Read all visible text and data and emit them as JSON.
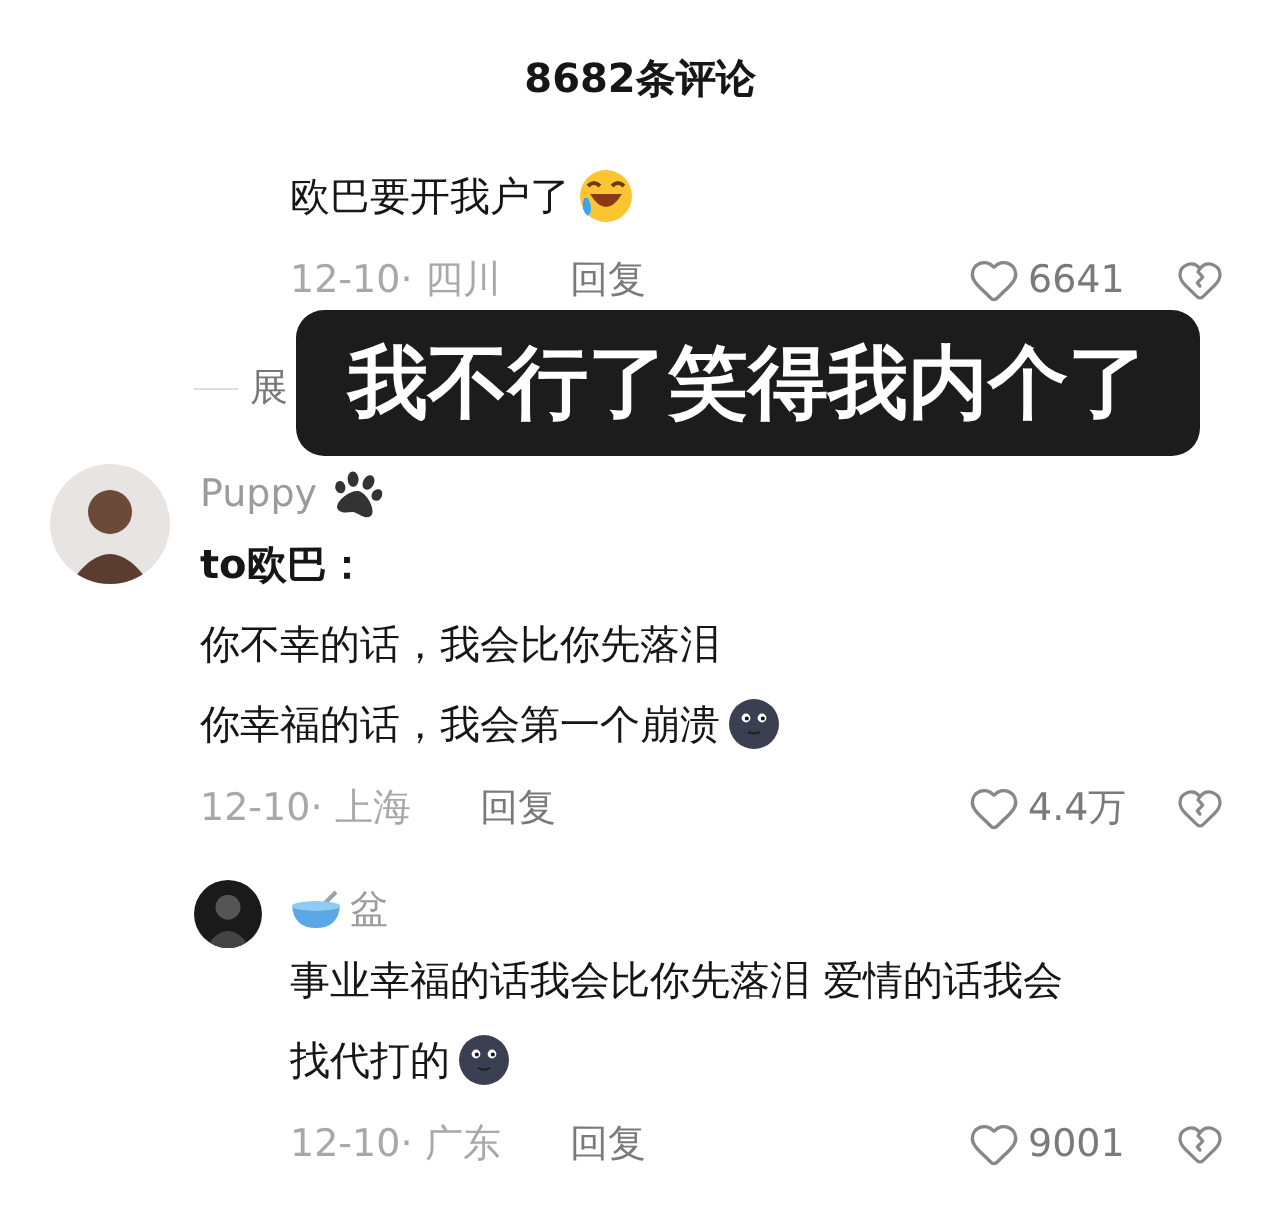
{
  "header": {
    "title": "8682条评论"
  },
  "comments": [
    {
      "indent": true,
      "lines": [
        "欧巴要开我户了"
      ],
      "emoji": {
        "kind": "laughing"
      },
      "meta": "12-10· 四川",
      "reply": "回复",
      "likes": "6641"
    },
    {
      "indent": false,
      "author": "Puppy",
      "badge": {
        "kind": "paw"
      },
      "lines": [
        "to欧巴：",
        "你不幸的话，我会比你先落泪",
        "你幸福的话，我会第一个崩溃"
      ],
      "emoji": {
        "kind": "moon"
      },
      "meta": "12-10· 上海",
      "reply": "回复",
      "likes": "4.4万"
    },
    {
      "indent": true,
      "author": "盆",
      "badge": {
        "kind": "bowl"
      },
      "lines": [
        "事业幸福的话我会比你先落泪 爱情的话我会",
        "找代打的"
      ],
      "emoji": {
        "kind": "moon"
      },
      "meta": "12-10· 广东",
      "reply": "回复",
      "likes": "9001"
    }
  ],
  "expand": {
    "text": "展"
  },
  "caption": {
    "text": "我不行了笑得我内个了"
  }
}
